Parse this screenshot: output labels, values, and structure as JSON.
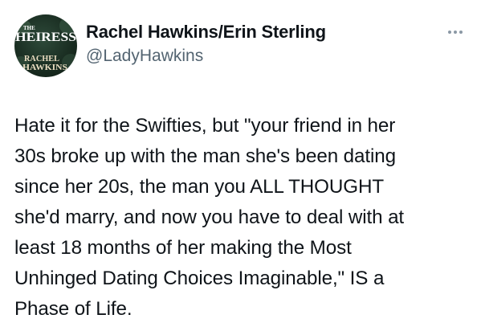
{
  "author": {
    "display_name": "Rachel Hawkins/Erin Sterling",
    "handle": "@LadyHawkins",
    "avatar": {
      "book_title_small": "THE",
      "book_title": "HEIRESS",
      "author_line1": "RACHEL",
      "author_line2": "HAWKINS",
      "colors": {
        "background": "#1e3328",
        "title": "#ffffff",
        "author": "#e8dcc0"
      }
    }
  },
  "more_icon": "more-horizontal-icon",
  "tweet": {
    "text": "Hate it for the Swifties, but \"your friend in her\n30s broke up with the man she's been dating\nsince her 20s, the man you ALL THOUGHT\nshe'd marry, and now you have to deal with at\nleast 18 months of her making the Most\nUnhinged Dating Choices Imaginable,\" IS a\nPhase of Life."
  },
  "colors": {
    "text": "#0f1419",
    "secondary": "#536471"
  }
}
